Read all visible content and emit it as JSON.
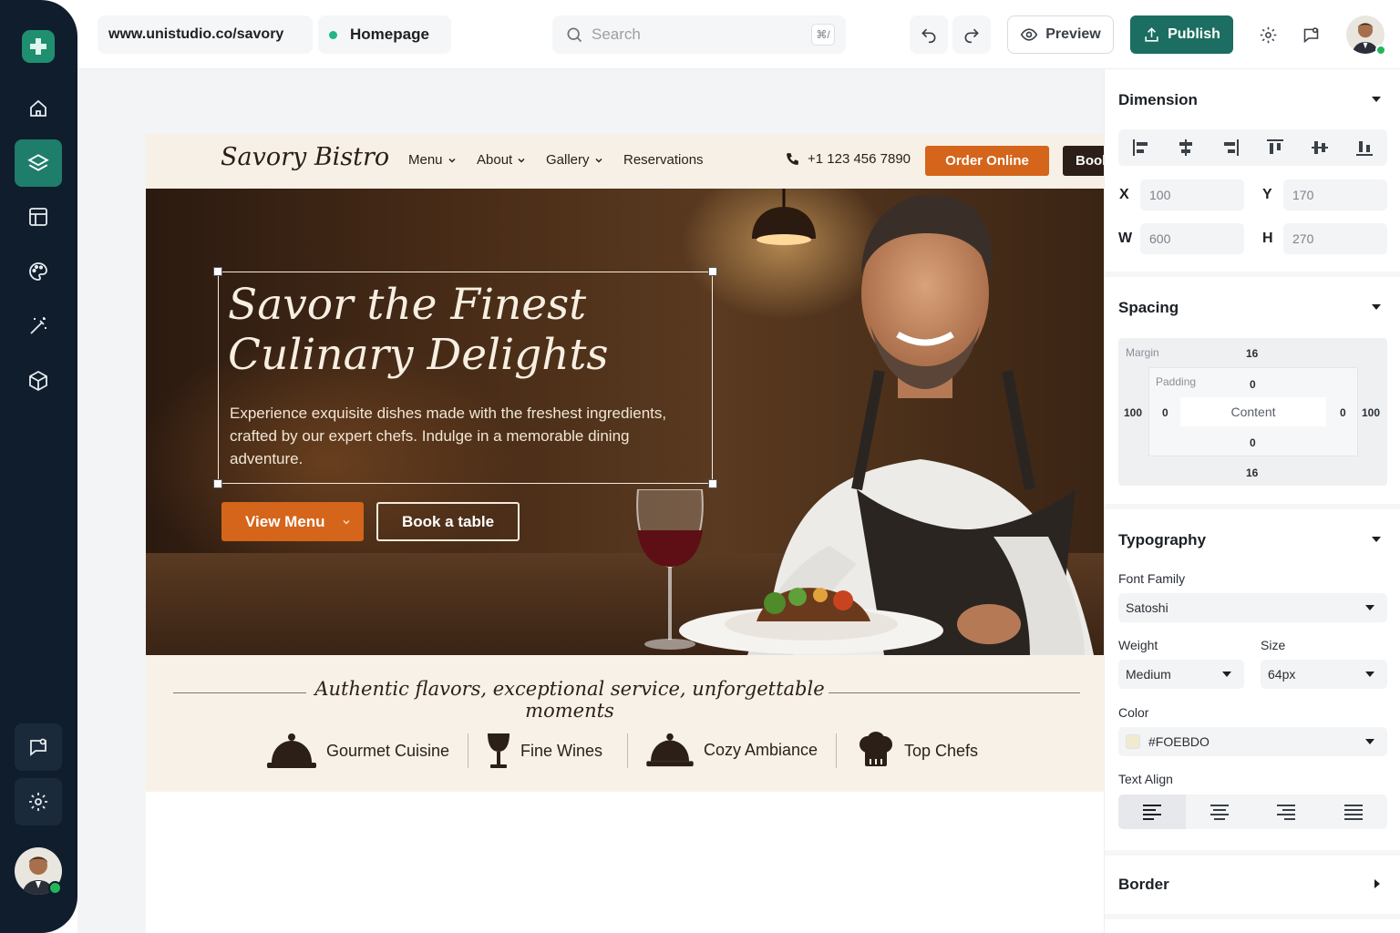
{
  "topbar": {
    "url": "www.unistudio.co/savory",
    "page_name": "Homepage",
    "search_placeholder": "Search",
    "search_shortcut": "⌘/",
    "preview_label": "Preview",
    "publish_label": "Publish"
  },
  "site": {
    "brand": "Savory Bistro",
    "nav": [
      {
        "label": "Menu",
        "has_dropdown": true
      },
      {
        "label": "About",
        "has_dropdown": true
      },
      {
        "label": "Gallery",
        "has_dropdown": true
      },
      {
        "label": "Reservations",
        "has_dropdown": false
      }
    ],
    "phone": "+1 123 456 7890",
    "order_online": "Order Online",
    "book": "Book",
    "hero": {
      "title_line1": "Savor the Finest",
      "title_line2": "Culinary Delights",
      "subtitle": "Experience exquisite dishes made with the freshest ingredients, crafted by our expert chefs. Indulge in a memorable dining adventure.",
      "primary_cta": "View Menu",
      "secondary_cta": "Book a table"
    },
    "tagline": "Authentic flavors, exceptional service, unforgettable moments",
    "features": [
      {
        "label": "Gourmet Cuisine",
        "icon": "cloche-icon"
      },
      {
        "label": "Fine Wines",
        "icon": "wine-glass-icon"
      },
      {
        "label": "Cozy Ambiance",
        "icon": "cloche-icon"
      },
      {
        "label": "Top Chefs",
        "icon": "chef-hat-icon"
      }
    ]
  },
  "panel": {
    "dimension": {
      "title": "Dimension",
      "x_label": "X",
      "x": "100",
      "y_label": "Y",
      "y": "170",
      "w_label": "W",
      "w": "600",
      "h_label": "H",
      "h": "270"
    },
    "spacing": {
      "title": "Spacing",
      "margin_label": "Margin",
      "padding_label": "Padding",
      "content_label": "Content",
      "margin_top": "16",
      "margin_bottom": "16",
      "margin_left": "100",
      "margin_right": "100",
      "padding_top": "0",
      "padding_bottom": "0",
      "padding_left": "0",
      "padding_right": "0"
    },
    "typography": {
      "title": "Typography",
      "font_family_label": "Font Family",
      "font_family": "Satoshi",
      "weight_label": "Weight",
      "weight": "Medium",
      "size_label": "Size",
      "size": "64px",
      "color_label": "Color",
      "color": "#FOEBDO",
      "text_align_label": "Text Align",
      "text_align": "left"
    },
    "border": {
      "title": "Border"
    }
  },
  "colors": {
    "rail": "#0f1d2c",
    "accent_teal": "#1b6e61",
    "accent_orange": "#d4651b",
    "swatch": "#f0ebd0"
  }
}
